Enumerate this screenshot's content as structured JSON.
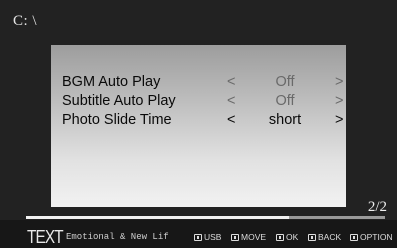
{
  "path": "C: \\",
  "settings": [
    {
      "label": "BGM Auto Play",
      "left": "<",
      "value": "Off",
      "right": ">"
    },
    {
      "label": "Subtitle Auto Play",
      "left": "<",
      "value": "Off",
      "right": ">"
    },
    {
      "label": "Photo Slide Time",
      "left": "<",
      "value": "short",
      "right": ">"
    }
  ],
  "page_indicator": "2/2",
  "footer": {
    "brand": "TEXT",
    "tagline": "Emotional & New Lif",
    "hints": [
      {
        "icon": "usb-key-icon",
        "label": "USB"
      },
      {
        "icon": "move-key-icon",
        "label": "MOVE"
      },
      {
        "icon": "ok-key-icon",
        "label": "OK"
      },
      {
        "icon": "back-key-icon",
        "label": "BACK"
      },
      {
        "icon": "option-key-icon",
        "label": "OPTION"
      }
    ]
  }
}
